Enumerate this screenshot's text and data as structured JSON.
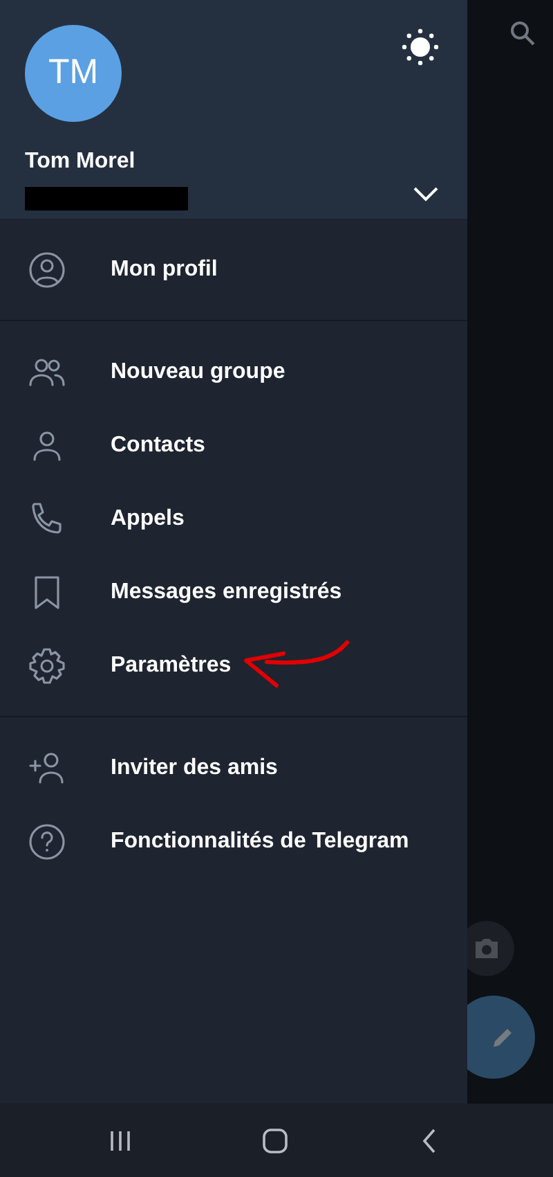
{
  "profile": {
    "initials": "TM",
    "name": "Tom Morel",
    "accounts_expanded": false
  },
  "menu_sections": [
    {
      "items": [
        {
          "label": "Mon profil",
          "marked": false
        }
      ]
    },
    {
      "items": [
        {
          "label": "Nouveau groupe",
          "marked": false
        },
        {
          "label": "Contacts",
          "marked": false
        },
        {
          "label": "Appels",
          "marked": false
        },
        {
          "label": "Messages enregistrés",
          "marked": false
        },
        {
          "label": "Paramètres",
          "marked": true
        }
      ]
    },
    {
      "items": [
        {
          "label": "Inviter des amis",
          "marked": false
        },
        {
          "label": "Fonctionnalités de Telegram",
          "marked": false
        }
      ]
    }
  ]
}
